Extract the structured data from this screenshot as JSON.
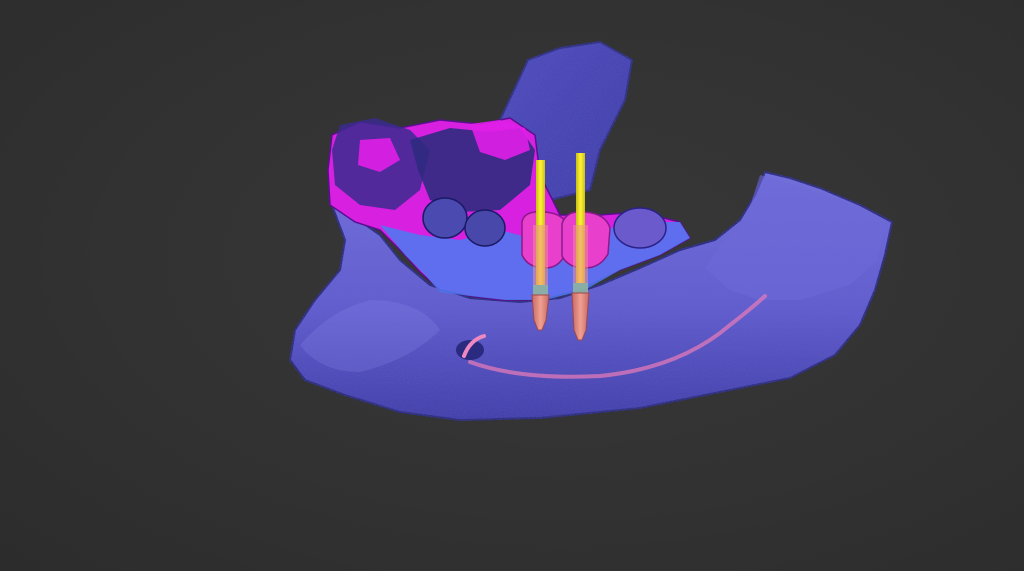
{
  "viewer": {
    "background_color": "#303030"
  },
  "model": {
    "bone_color": "#6b66d8",
    "bone_shadow_color": "#2a2a8a",
    "gingiva_color": "#e01ee8",
    "scan_color": "#4a7ef0",
    "crown_color": "#e040c8",
    "nerve_color": "#e27ab8",
    "drill_guide_color": "#f2e81e",
    "implant_color": "#e88a80",
    "implant_count": 2
  }
}
